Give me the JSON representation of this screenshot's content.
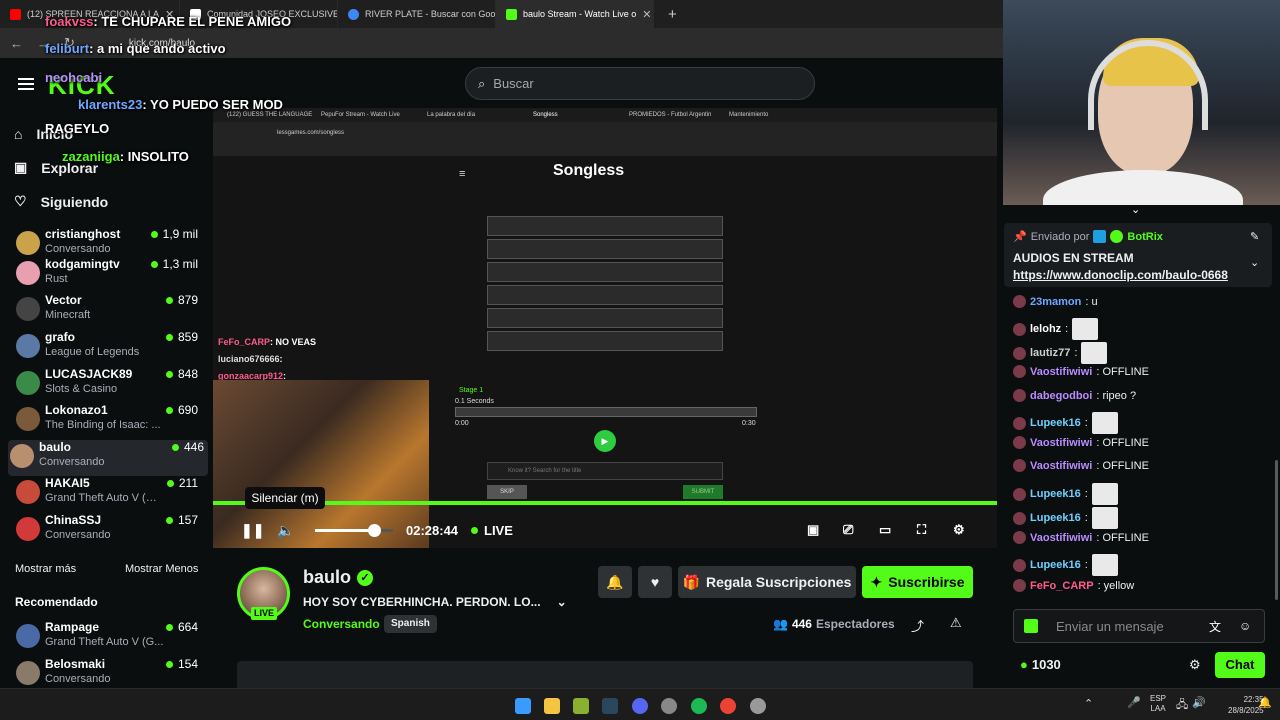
{
  "browser": {
    "tabs": [
      {
        "label": "(12) SPREEN REACCIONA A LA",
        "color": "#ff0000"
      },
      {
        "label": "Comunidad JOSEO EXCLUSIVE",
        "color": "#ffffff"
      },
      {
        "label": "RIVER PLATE - Buscar con Goo",
        "color": "#4285f4"
      },
      {
        "label": "baulo Stream - Watch Live o",
        "color": "#53fc18"
      }
    ],
    "new_tab": "+",
    "url": "kick.com/baulo"
  },
  "overlay_chat": [
    {
      "user": "foakvss",
      "text": ": TE CHUPARE EL PENE AMIGO",
      "color": "#ff5b8a"
    },
    {
      "user": "feliburt",
      "text": ": a mi que ando activo",
      "color": "#6fa7ff"
    },
    {
      "user": "neohcabi",
      "text": "",
      "color": "#b98cff"
    },
    {
      "user": "klarents23",
      "text": ": YO PUEDO SER MOD",
      "color": "#6fa7ff"
    },
    {
      "user": "RAGEYLO",
      "text": "",
      "color": "#ffffff"
    },
    {
      "user": "zazaniiga",
      "text": ": INSOLITO",
      "color": "#53fc18"
    }
  ],
  "sidebar": {
    "nav": [
      {
        "label": "Inicio",
        "icon": "home-icon"
      },
      {
        "label": "Explorar",
        "icon": "compass-icon"
      },
      {
        "label": "Siguiendo",
        "icon": "heart-icon"
      }
    ],
    "following": [
      {
        "name": "cristianghost",
        "category": "Conversando",
        "viewers": "1,9 mil",
        "color": "#c9a24a"
      },
      {
        "name": "kodgamingtv",
        "category": "Rust",
        "viewers": "1,3 mil",
        "color": "#e8a0b0"
      },
      {
        "name": "Vector",
        "category": "Minecraft",
        "viewers": "879",
        "color": "#444444"
      },
      {
        "name": "grafo",
        "category": "League of Legends",
        "viewers": "859",
        "color": "#5a7aa5"
      },
      {
        "name": "LUCASJACK89",
        "category": "Slots & Casino",
        "viewers": "848",
        "color": "#3a8a4a"
      },
      {
        "name": "Lokonazo1",
        "category": "The Binding of Isaac: ...",
        "viewers": "690",
        "color": "#7a5a3a"
      },
      {
        "name": "baulo",
        "category": "Conversando",
        "viewers": "446",
        "color": "#b89070"
      },
      {
        "name": "HAKAI5",
        "category": "Grand Theft Auto V (GT...",
        "viewers": "211",
        "color": "#c84a3a"
      },
      {
        "name": "ChinaSSJ",
        "category": "Conversando",
        "viewers": "157",
        "color": "#d23a3a"
      }
    ],
    "show_more": "Mostrar más",
    "show_less": "Mostrar Menos",
    "recommended_title": "Recomendado",
    "recommended": [
      {
        "name": "Rampage",
        "category": "Grand Theft Auto V (G...",
        "viewers": "664",
        "color": "#4a6aa5"
      },
      {
        "name": "Belosmaki",
        "category": "Conversando",
        "viewers": "154",
        "color": "#8a7a6a"
      }
    ]
  },
  "search": {
    "placeholder": "Buscar"
  },
  "player": {
    "inner_tabs": [
      "(122) GUESS THE LANGUAGE",
      "PepuFor Stream - Watch Live",
      "La palabra del día",
      "Songless",
      "PROMIEDOS - Futbol Argentin",
      "Mantenimiento"
    ],
    "inner_url": "lessgames.com/songless",
    "game_title": "Songless",
    "stage_label": "Stage 1",
    "stage_time": "0.1 Seconds",
    "time_start": "0:00",
    "time_end": "0:30",
    "search_placeholder": "Know it? Search for the title",
    "skip": "SKIP",
    "submit": "SUBMIT",
    "small_chat": [
      {
        "user": "FeFo_CARP",
        "text": ": NO",
        "extra": "VEAS"
      },
      {
        "user": "luciano676666",
        "text": ":"
      },
      {
        "user": "gonzaacarp912",
        "text": ":"
      }
    ],
    "tooltip": "Silenciar (m)",
    "time": "02:28:44",
    "live": "LIVE",
    "volume": 0.75
  },
  "stream": {
    "name": "baulo",
    "title": "HOY SOY CYBERHINCHA. PERDON. LO...",
    "category": "Conversando",
    "language": "Spanish",
    "live_badge": "LIVE",
    "gift_label": "Regala Suscripciones",
    "subscribe_label": "Suscribirse",
    "viewers": "446",
    "viewers_label": "Espectadores"
  },
  "chat": {
    "pinned_by_label": "Enviado por",
    "pinned_by": "BotRix",
    "pinned_title": "AUDIOS EN STREAM",
    "pinned_link": "https://www.donoclip.com/baulo-0668",
    "messages": [
      {
        "user": "23mamon",
        "text": ": u",
        "color": "#6fa7ff",
        "emote": false
      },
      {
        "user": "lelohz",
        "text": ":",
        "color": "#ffffff",
        "emote": true
      },
      {
        "user": "lautiz77",
        "text": ":",
        "color": "#cfcfcf",
        "emote": true
      },
      {
        "user": "Vaostifiwiwi",
        "text": ": OFFLINE",
        "color": "#b98cff",
        "emote": false
      },
      {
        "user": "dabegodboi",
        "text": ": ripeo ?",
        "color": "#b98cff",
        "emote": false
      },
      {
        "user": "Lupeek16",
        "text": ":",
        "color": "#6fd0ff",
        "emote": true
      },
      {
        "user": "Vaostifiwiwi",
        "text": ": OFFLINE",
        "color": "#b98cff",
        "emote": false
      },
      {
        "user": "Vaostifiwiwi",
        "text": ": OFFLINE",
        "color": "#b98cff",
        "emote": false
      },
      {
        "user": "Lupeek16",
        "text": ":",
        "color": "#6fd0ff",
        "emote": true
      },
      {
        "user": "Lupeek16",
        "text": ":",
        "color": "#6fd0ff",
        "emote": true
      },
      {
        "user": "Vaostifiwiwi",
        "text": ": OFFLINE",
        "color": "#b98cff",
        "emote": false
      },
      {
        "user": "Lupeek16",
        "text": ":",
        "color": "#6fd0ff",
        "emote": true
      },
      {
        "user": "FeFo_CARP",
        "text": ": yellow",
        "color": "#ff5b8a",
        "emote": false
      }
    ],
    "input_placeholder": "Enviar un mensaje",
    "points": "1030",
    "send_label": "Chat"
  },
  "taskbar": {
    "lang_top": "ESP",
    "lang_bottom": "LAA",
    "time": "22:35",
    "date": "28/8/2025"
  },
  "colors": {
    "accent": "#53fc18",
    "bg": "#0b0e0f"
  }
}
